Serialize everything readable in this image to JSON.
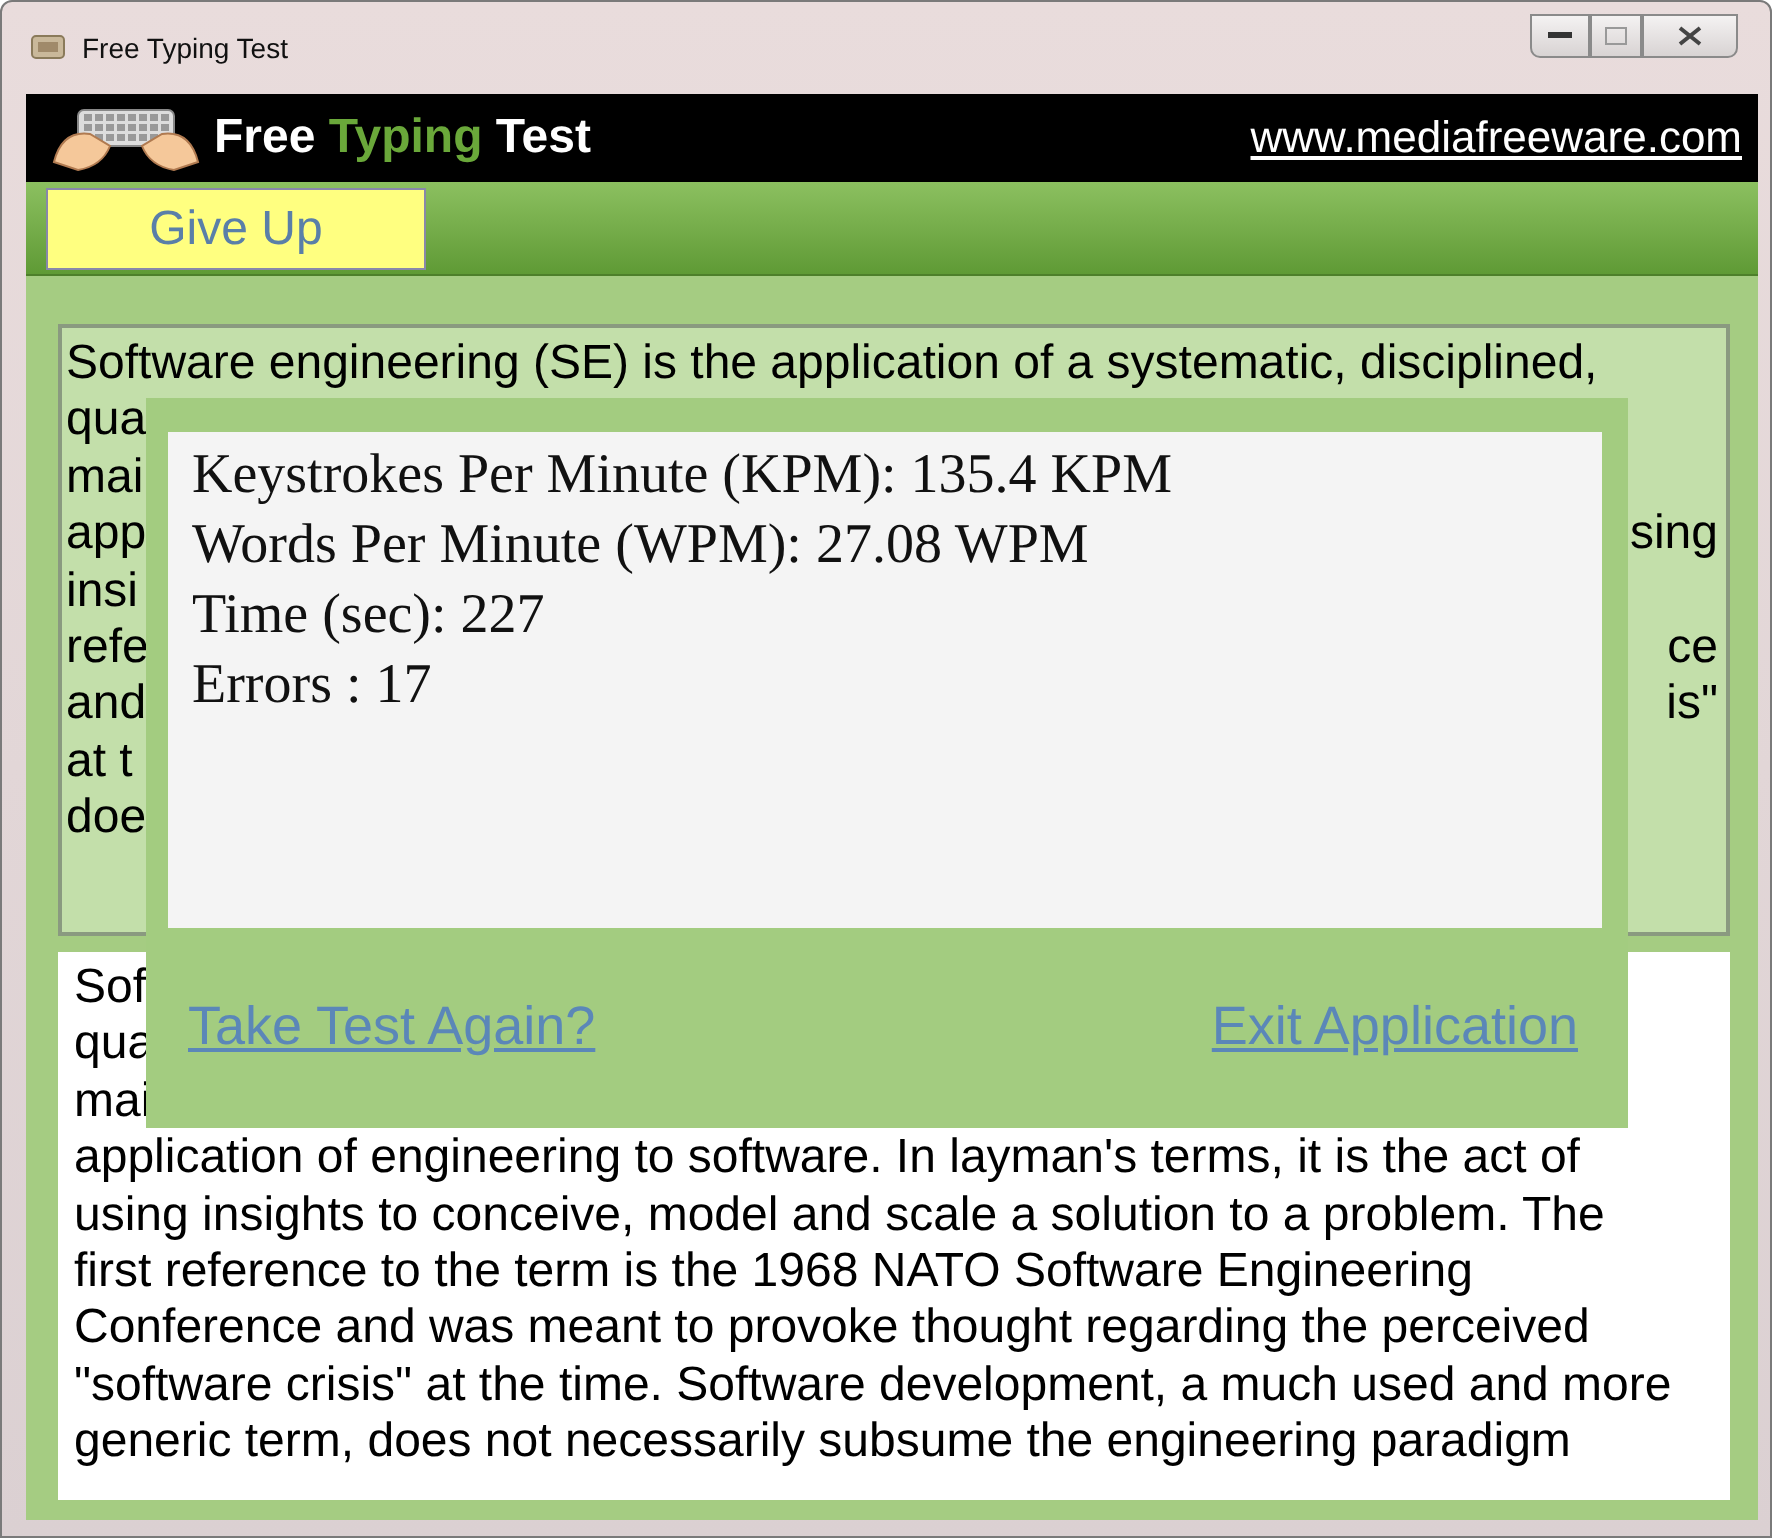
{
  "window": {
    "title": "Free Typing Test"
  },
  "header": {
    "brand": [
      {
        "text": "Free ",
        "accent": false
      },
      {
        "text": "Typing",
        "accent": true
      },
      {
        "text": " Test",
        "accent": false
      }
    ],
    "link": "www.mediafreeware.com"
  },
  "toolbar": {
    "button": "Give Up"
  },
  "reference_text": [
    {
      "left": "Software engineering (SE) is the application of a systematic, disciplined,"
    },
    {
      "left": "qua"
    },
    {
      "left": "mai"
    },
    {
      "left": "app",
      "right": "sing"
    },
    {
      "left": "insi"
    },
    {
      "left": "refe",
      "right": "ce"
    },
    {
      "left": "and",
      "right": "is\""
    },
    {
      "left": "at t"
    },
    {
      "left": "doe"
    }
  ],
  "typed_text": [
    {
      "left": "Sof"
    },
    {
      "left": "qua"
    },
    {
      "left": "mai"
    },
    {
      "left": "application of engineering to software. In layman's terms, it is the act of"
    },
    {
      "left": "using insights to conceive, model and scale a solution to a problem. The"
    },
    {
      "left": "first reference to the term is the 1968 NATO Software Engineering"
    },
    {
      "left": "Conference and was meant to provoke thought regarding the perceived"
    },
    {
      "left": "\"software crisis\" at the time. Software development, a much used and more"
    },
    {
      "left": "generic term, does not necessarily subsume the engineering paradigm"
    }
  ],
  "results": {
    "lines": [
      "Keystrokes Per Minute (KPM): 135.4 KPM",
      "Words Per Minute (WPM): 27.08 WPM",
      "Time (sec): 227",
      "Errors : 17"
    ],
    "links": [
      "Take Test Again?",
      "Exit Application"
    ]
  }
}
